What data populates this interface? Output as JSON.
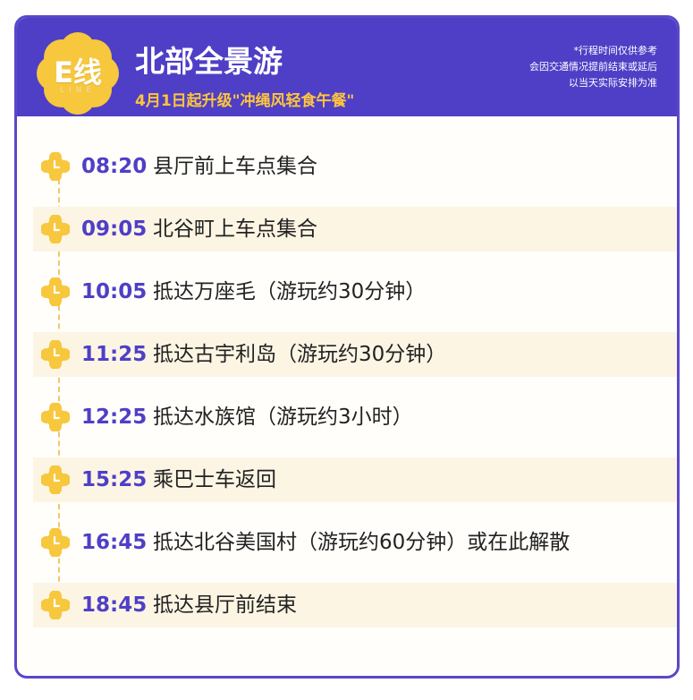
{
  "header": {
    "badge_main": "E线",
    "badge_sub": "LINE",
    "title": "北部全景游",
    "subtitle": "4月1日起升级\"冲绳风轻食午餐\"",
    "note_lines": [
      "*行程时间仅供参考",
      "会因交通情况提前结束或延后",
      "以当天实际安排为准"
    ]
  },
  "schedule": [
    {
      "time": "08:20",
      "desc": "县厅前上车点集合"
    },
    {
      "time": "09:05",
      "desc": "北谷町上车点集合"
    },
    {
      "time": "10:05",
      "desc": "抵达万座毛（游玩约30分钟）"
    },
    {
      "time": "11:25",
      "desc": "抵达古宇利岛（游玩约30分钟）"
    },
    {
      "time": "12:25",
      "desc": "抵达水族馆（游玩约3小时）"
    },
    {
      "time": "15:25",
      "desc": "乘巴士车返回"
    },
    {
      "time": "16:45",
      "desc": "抵达北谷美国村（游玩约60分钟）或在此解散"
    },
    {
      "time": "18:45",
      "desc": "抵达县厅前结束"
    }
  ],
  "colors": {
    "header_bg": "#4f3fc6",
    "accent_yellow": "#ffc53d",
    "time_color": "#4f3fc6",
    "row_shade": "#fcf5e4"
  },
  "icons": {
    "badge": "flower-badge-icon",
    "timeline_marker": "clock-icon"
  }
}
